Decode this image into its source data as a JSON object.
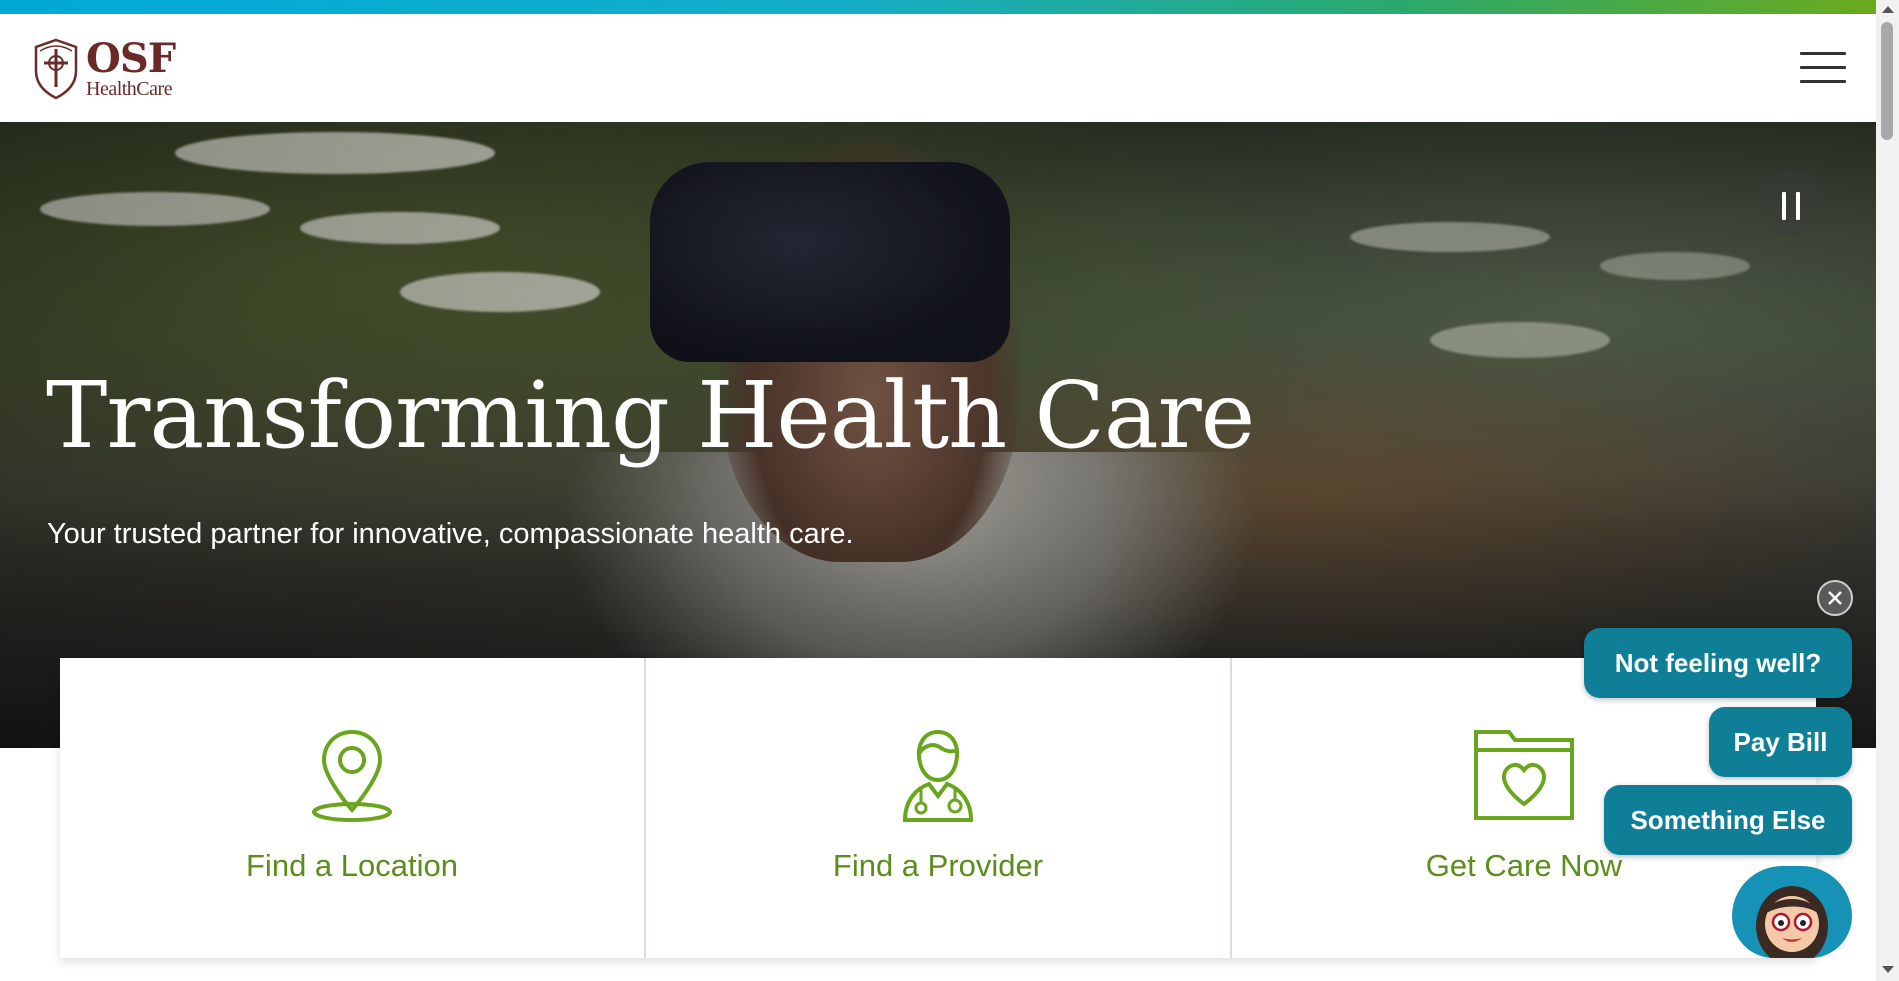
{
  "header": {
    "logo_line1": "OSF",
    "logo_line2": "HealthCare",
    "menu_icon": "hamburger-menu-icon"
  },
  "hero": {
    "title": "Transforming Health Care",
    "subtitle": "Your trusted partner for innovative, compassionate health care.",
    "pause_icon": "pause-icon"
  },
  "cards": [
    {
      "label": "Find a Location",
      "icon": "location-pin-icon"
    },
    {
      "label": "Find a Provider",
      "icon": "doctor-icon"
    },
    {
      "label": "Get Care Now",
      "icon": "folder-heart-icon"
    }
  ],
  "chat": {
    "options": [
      "Not feeling well?",
      "Pay Bill",
      "Something Else"
    ],
    "close_icon": "close-icon",
    "avatar_icon": "assistant-avatar"
  },
  "colors": {
    "brand_green": "#5c8c1c",
    "chat_teal": "#0e7f97",
    "logo_maroon": "#6b2a2a"
  }
}
